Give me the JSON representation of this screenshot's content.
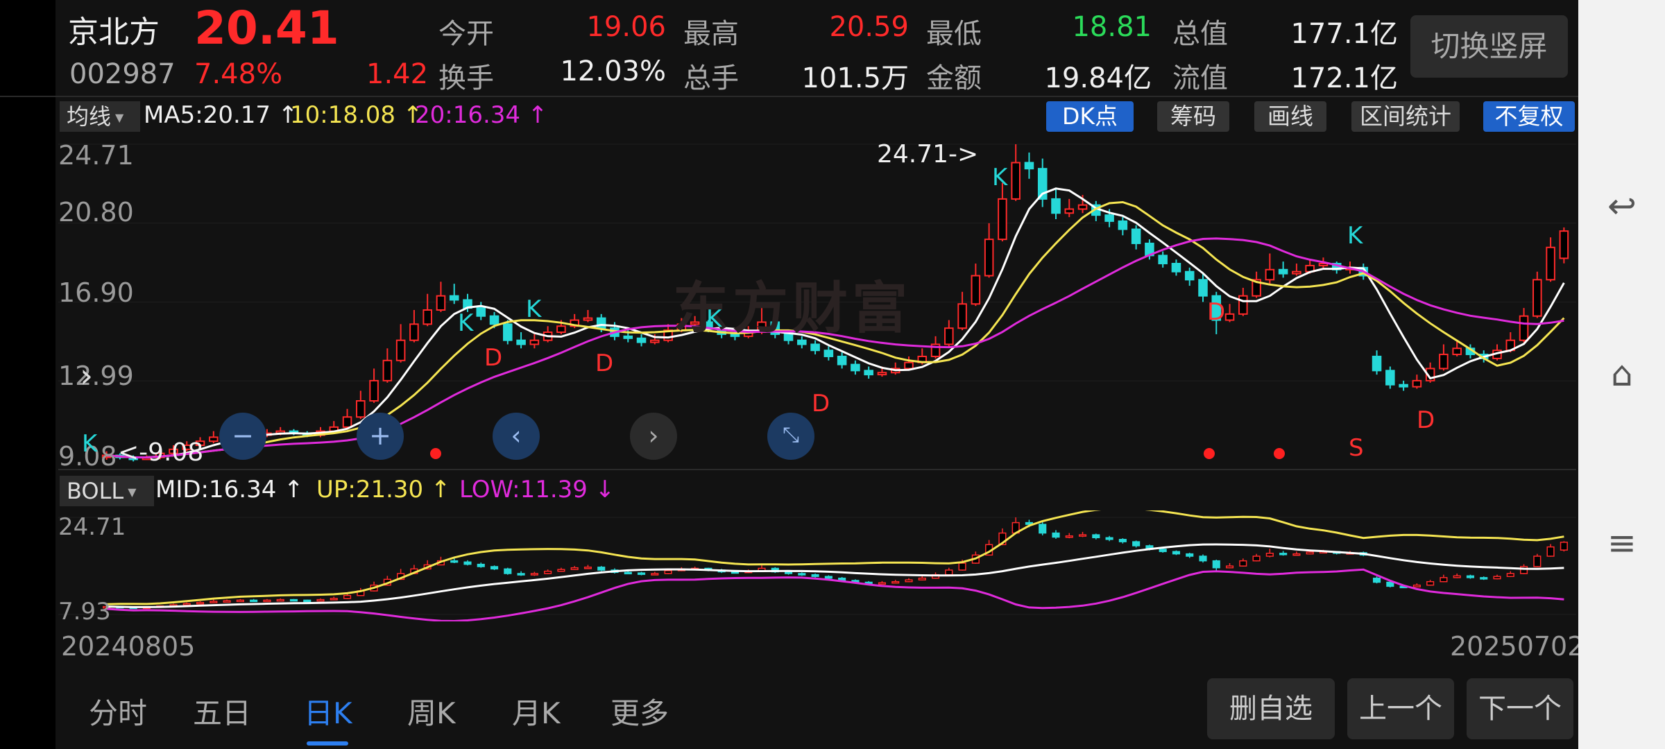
{
  "header": {
    "stock_name": "京北方",
    "price": "20.41",
    "code": "002987",
    "change_pct": "7.48%",
    "change_amt": "1.42",
    "stats": [
      {
        "label": "今开",
        "value": "19.06",
        "color": "red"
      },
      {
        "label": "最高",
        "value": "20.59",
        "color": "red"
      },
      {
        "label": "最低",
        "value": "18.81",
        "color": "green"
      },
      {
        "label": "总值",
        "value": "177.1亿",
        "color": "white"
      },
      {
        "label": "换手",
        "value": "12.03%",
        "color": "white"
      },
      {
        "label": "总手",
        "value": "101.5万",
        "color": "white"
      },
      {
        "label": "金额",
        "value": "19.84亿",
        "color": "white"
      },
      {
        "label": "流值",
        "value": "172.1亿",
        "color": "white"
      }
    ],
    "switch_label": "切换竖屏"
  },
  "ma_bar": {
    "select_label": "均线",
    "ma5": "MA5:20.17 ↑",
    "ma10": "10:18.08 ↑",
    "ma20": "20:16.34 ↑",
    "buttons": [
      "DK点",
      "筹码",
      "画线",
      "区间统计",
      "不复权"
    ]
  },
  "main_chart": {
    "y_labels": [
      "24.71",
      "20.80",
      "16.90",
      "12.99",
      "9.08"
    ],
    "high_marker": "24.71->",
    "low_marker": "<-9.08",
    "watermark": "东方财富"
  },
  "boll_bar": {
    "select_label": "BOLL",
    "mid": "MID:16.34 ↑",
    "up": "UP:21.30 ↑",
    "low": "LOW:11.39 ↓"
  },
  "sub_chart": {
    "y_labels": [
      "24.71",
      "7.93"
    ]
  },
  "dates": {
    "start": "20240805",
    "end": "20250702"
  },
  "tabs": [
    "分时",
    "五日",
    "日K",
    "周K",
    "月K",
    "更多"
  ],
  "active_tab": "日K",
  "bottom_buttons": [
    "删自选",
    "上一个",
    "下一个"
  ],
  "signals": {
    "k": "K",
    "d": "D",
    "s": "S"
  },
  "colors": {
    "up": "#ff2a2a",
    "down": "#26d8d8",
    "ma5": "#ffffff",
    "ma10": "#f5e552",
    "ma20": "#e02bdc",
    "accent": "#2d7ff0"
  },
  "chart_data": {
    "type": "candlestick",
    "x_start": "20240805",
    "x_end": "20250702",
    "ylim": [
      9.08,
      24.71
    ],
    "close": [
      9.3,
      9.2,
      9.1,
      9.2,
      9.4,
      9.6,
      9.8,
      10.0,
      10.2,
      10.3,
      10.4,
      10.3,
      10.4,
      10.5,
      10.4,
      10.3,
      10.5,
      10.7,
      11.2,
      12.0,
      13.0,
      14.0,
      15.0,
      15.8,
      16.5,
      17.2,
      17.0,
      16.6,
      16.2,
      15.8,
      15.0,
      14.8,
      15.0,
      15.4,
      15.7,
      16.0,
      16.1,
      15.6,
      15.2,
      15.1,
      14.9,
      15.0,
      15.5,
      15.8,
      15.9,
      15.6,
      15.3,
      15.2,
      15.4,
      15.9,
      15.3,
      15.0,
      14.8,
      14.5,
      14.2,
      13.8,
      13.5,
      13.3,
      13.4,
      13.6,
      13.9,
      14.2,
      14.8,
      15.6,
      16.8,
      18.2,
      20.0,
      22.0,
      23.8,
      23.5,
      22.0,
      21.3,
      21.5,
      21.7,
      21.2,
      20.9,
      20.5,
      19.8,
      19.2,
      18.8,
      18.4,
      18.0,
      17.2,
      16.0,
      16.3,
      17.2,
      18.0,
      18.5,
      18.3,
      18.4,
      18.7,
      18.8,
      18.5,
      18.6,
      18.2,
      13.5,
      12.8,
      12.7,
      13.0,
      13.6,
      14.3,
      14.6,
      14.3,
      14.1,
      14.5,
      15.0,
      16.2,
      18.0,
      19.6,
      20.41
    ],
    "open": [
      9.2,
      9.3,
      9.2,
      9.1,
      9.2,
      9.4,
      9.6,
      9.8,
      10.0,
      10.2,
      10.3,
      10.4,
      10.3,
      10.4,
      10.5,
      10.4,
      10.3,
      10.5,
      10.7,
      11.2,
      12.0,
      13.0,
      14.0,
      15.0,
      15.8,
      16.5,
      17.2,
      17.0,
      16.6,
      16.2,
      15.8,
      15.0,
      14.8,
      15.0,
      15.4,
      15.7,
      16.0,
      16.1,
      15.6,
      15.2,
      15.1,
      14.9,
      15.0,
      15.5,
      15.8,
      15.9,
      15.6,
      15.3,
      15.2,
      15.4,
      15.9,
      15.3,
      15.0,
      14.8,
      14.5,
      14.2,
      13.8,
      13.5,
      13.3,
      13.4,
      13.6,
      13.9,
      14.2,
      14.8,
      15.6,
      16.8,
      18.2,
      20.0,
      22.0,
      23.8,
      23.5,
      22.0,
      21.3,
      21.5,
      21.7,
      21.2,
      20.9,
      20.5,
      19.8,
      19.2,
      18.8,
      18.4,
      18.0,
      17.2,
      16.0,
      16.3,
      17.2,
      18.0,
      18.5,
      18.3,
      18.4,
      18.7,
      18.8,
      18.5,
      18.6,
      14.2,
      13.5,
      12.8,
      12.7,
      13.0,
      13.6,
      14.3,
      14.6,
      14.3,
      14.1,
      14.5,
      15.0,
      16.2,
      18.0,
      19.06
    ],
    "high": [
      9.5,
      9.4,
      9.3,
      9.3,
      9.5,
      9.8,
      10.0,
      10.2,
      10.5,
      10.5,
      10.6,
      10.6,
      10.6,
      10.7,
      10.6,
      10.5,
      10.7,
      11.0,
      11.6,
      12.5,
      13.6,
      14.6,
      15.8,
      16.5,
      17.3,
      17.9,
      17.8,
      17.3,
      16.9,
      16.4,
      16.0,
      15.4,
      15.3,
      15.7,
      16.0,
      16.3,
      16.5,
      16.3,
      15.9,
      15.5,
      15.3,
      15.3,
      15.8,
      16.1,
      16.2,
      16.0,
      15.8,
      15.5,
      15.7,
      16.6,
      16.1,
      15.5,
      15.2,
      15.0,
      14.7,
      14.4,
      14.0,
      13.7,
      13.7,
      13.9,
      14.2,
      14.6,
      15.2,
      16.0,
      17.4,
      18.8,
      20.8,
      22.8,
      24.71,
      24.3,
      24.0,
      22.5,
      22.0,
      22.2,
      21.9,
      21.5,
      21.1,
      20.7,
      20.0,
      19.4,
      19.0,
      18.6,
      18.3,
      17.4,
      16.8,
      17.6,
      18.4,
      19.3,
      18.9,
      18.8,
      19.0,
      19.1,
      18.9,
      18.9,
      18.8,
      14.5,
      13.7,
      13.0,
      13.3,
      13.9,
      14.8,
      15.0,
      14.8,
      14.5,
      14.8,
      15.4,
      16.6,
      18.4,
      20.1,
      20.59
    ],
    "low": [
      9.08,
      9.1,
      9.0,
      9.1,
      9.1,
      9.3,
      9.5,
      9.7,
      9.9,
      10.1,
      10.2,
      10.2,
      10.2,
      10.3,
      10.3,
      10.2,
      10.2,
      10.4,
      10.6,
      11.1,
      11.9,
      12.9,
      13.9,
      14.9,
      15.7,
      16.4,
      16.8,
      16.4,
      16.0,
      15.6,
      14.8,
      14.6,
      14.6,
      14.9,
      15.3,
      15.6,
      15.9,
      15.4,
      15.0,
      14.9,
      14.7,
      14.8,
      14.9,
      15.4,
      15.6,
      15.4,
      15.1,
      15.0,
      15.1,
      15.3,
      15.1,
      14.8,
      14.6,
      14.3,
      14.0,
      13.6,
      13.3,
      13.1,
      13.2,
      13.3,
      13.5,
      13.8,
      14.1,
      14.7,
      15.5,
      16.7,
      18.1,
      19.9,
      21.9,
      23.0,
      21.6,
      21.0,
      21.1,
      21.3,
      20.9,
      20.6,
      20.2,
      19.5,
      19.0,
      18.6,
      18.2,
      17.7,
      16.9,
      15.3,
      15.9,
      16.2,
      17.1,
      17.8,
      18.1,
      18.2,
      18.3,
      18.5,
      18.3,
      18.3,
      18.0,
      13.3,
      12.6,
      12.5,
      12.6,
      12.9,
      13.5,
      14.2,
      14.1,
      13.9,
      14.0,
      14.4,
      14.9,
      16.1,
      17.9,
      18.81
    ]
  }
}
